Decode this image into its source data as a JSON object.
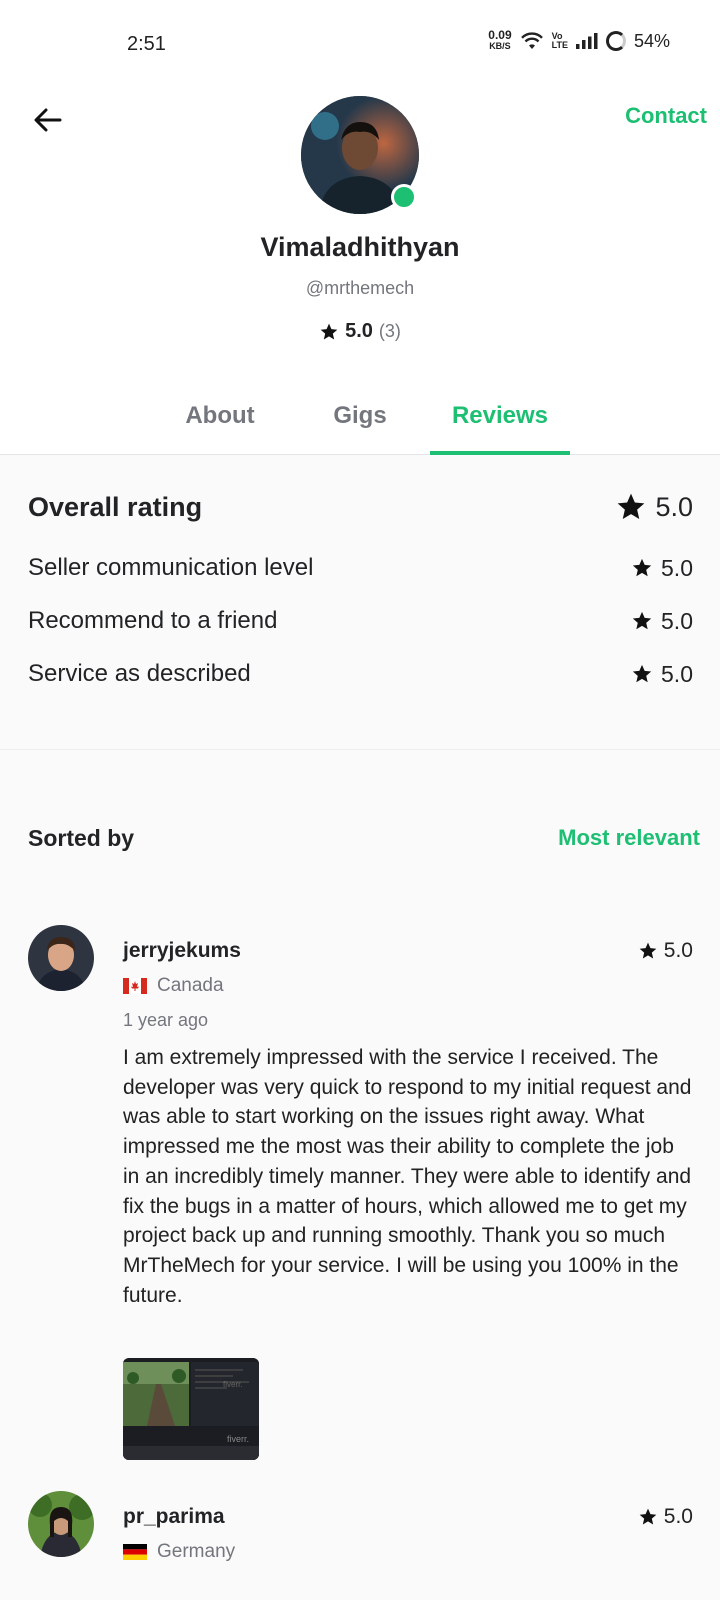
{
  "status_bar": {
    "time": "2:51",
    "net_speed": "0.09",
    "net_unit": "KB/S",
    "volte_top": "Vo",
    "volte_bottom": "LTE",
    "battery": "54%"
  },
  "header": {
    "contact_label": "Contact",
    "name": "Vimaladhithyan",
    "handle": "@mrthemech",
    "rating": "5.0",
    "rating_count": "(3)"
  },
  "tabs": [
    {
      "label": "About",
      "active": false
    },
    {
      "label": "Gigs",
      "active": false
    },
    {
      "label": "Reviews",
      "active": true
    }
  ],
  "ratings": {
    "overall_label": "Overall rating",
    "overall_value": "5.0",
    "items": [
      {
        "label": "Seller communication level",
        "value": "5.0"
      },
      {
        "label": "Recommend to a friend",
        "value": "5.0"
      },
      {
        "label": "Service as described",
        "value": "5.0"
      }
    ]
  },
  "sort": {
    "label": "Sorted by",
    "value": "Most relevant"
  },
  "reviews": [
    {
      "user": "jerryjekums",
      "country": "Canada",
      "time": "1 year ago",
      "rating": "5.0",
      "text": "I am extremely impressed with the service I received. The developer was very quick to respond to my initial request and was able to start working on the issues right away. What impressed me the most was their ability to complete the job in an incredibly timely manner. They were able to identify and fix the bugs in a matter of hours, which allowed me to get my project back up and running smoothly. Thank you so much MrTheMech for your service. I will be using you 100% in the future.",
      "attachment_watermark": "fiverr."
    },
    {
      "user": "pr_parima",
      "country": "Germany",
      "rating": "5.0"
    }
  ],
  "colors": {
    "brand": "#1dbf73",
    "muted": "#74767e",
    "text": "#222325"
  }
}
